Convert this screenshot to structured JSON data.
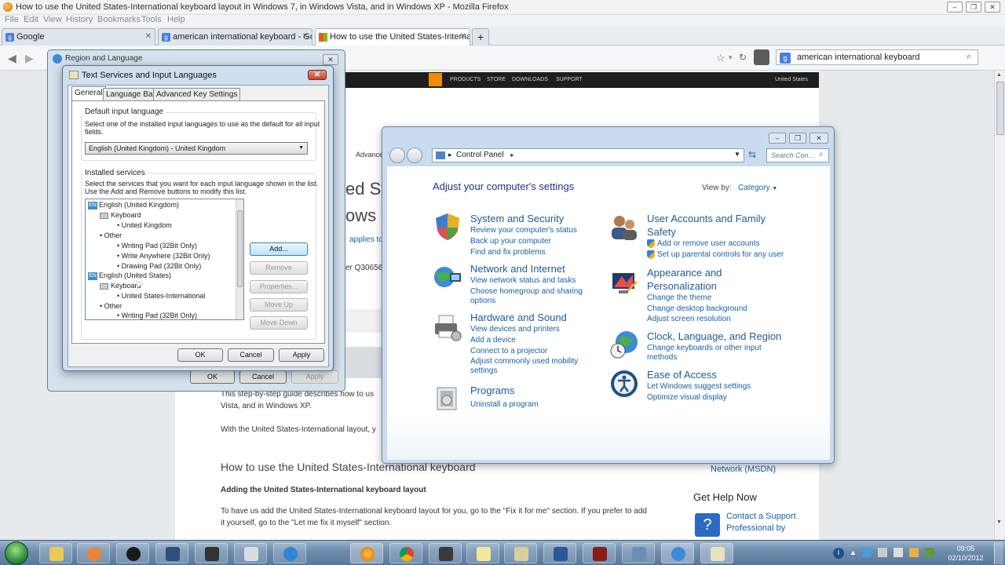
{
  "browser": {
    "title": "How to use the United States-International keyboard layout in Windows 7, in Windows Vista, and in Windows XP - Mozilla Firefox",
    "menu": [
      "File",
      "Edit",
      "View",
      "History",
      "Bookmarks",
      "Tools",
      "Help"
    ],
    "tabs": [
      {
        "label": "Google"
      },
      {
        "label": "american international keyboard - Go..."
      },
      {
        "label": "How to use the United States-Internat..."
      }
    ],
    "search_value": "american international keyboard"
  },
  "ms_header": {
    "links": [
      "PRODUCTS",
      "STORE",
      "DOWNLOADS",
      "SUPPORT"
    ],
    "region": "United States"
  },
  "article": {
    "frag_advanced": "Advance",
    "frag_title1": "ed St",
    "frag_title2": "ows",
    "frag_applies": "applies to",
    "frag_kb": "er Q30656",
    "para1_line1": "This step-by-step guide describes how to us",
    "para1_line2": "Vista, and in Windows XP.",
    "para2": "With the United States-International layout, y",
    "heading": "How to use the United States-International keyboard",
    "subheading": "Adding the United States-International keyboard layout",
    "body_line1": "To have us add the United States-International keyboard layout for you, go to the \"Fix it for me\" section. If you prefer to add",
    "body_line2": "it yourself, go to the \"Let me fix it myself\" section.",
    "side_msdn": "Network (MSDN)",
    "side_help": "Get Help Now",
    "side_contact": "Contact a Support",
    "side_prof": "Professional by"
  },
  "control_panel": {
    "address": "Control Panel",
    "search_placeholder": "Search Con...",
    "heading": "Adjust your computer's settings",
    "view_by_label": "View by:",
    "view_by_value": "Category",
    "categories": [
      {
        "title": "System and Security",
        "links": [
          "Review your computer's status",
          "Back up your computer",
          "Find and fix problems"
        ]
      },
      {
        "title": "Network and Internet",
        "links": [
          "View network status and tasks",
          "Choose homegroup and sharing",
          "options"
        ]
      },
      {
        "title": "Hardware and Sound",
        "links": [
          "View devices and printers",
          "Add a device",
          "Connect to a projector",
          "Adjust commonly used mobility",
          "settings"
        ]
      },
      {
        "title": "Programs",
        "links": [
          "Uninstall a program"
        ]
      },
      {
        "title": "User Accounts and Family",
        "title2": "Safety",
        "links": [
          "Add or remove user accounts",
          "Set up parental controls for any user"
        ]
      },
      {
        "title": "Appearance and",
        "title2": "Personalization",
        "links": [
          "Change the theme",
          "Change desktop background",
          "Adjust screen resolution"
        ]
      },
      {
        "title": "Clock, Language, and Region",
        "links": [
          "Change keyboards or other input",
          "methods"
        ]
      },
      {
        "title": "Ease of Access",
        "links": [
          "Let Windows suggest settings",
          "Optimize visual display"
        ]
      }
    ]
  },
  "region_dialog": {
    "title": "Region and Language",
    "ok": "OK",
    "cancel": "Cancel",
    "apply": "Apply"
  },
  "text_services": {
    "title": "Text Services and Input Languages",
    "tabs": [
      "General",
      "Language Bar",
      "Advanced Key Settings"
    ],
    "default_group": "Default input language",
    "default_desc1": "Select one of the installed input languages to use as the default for all input",
    "default_desc2": "fields.",
    "default_value": "English (United Kingdom) - United Kingdom",
    "installed_group": "Installed services",
    "installed_desc1": "Select the services that you want for each input language shown in the list.",
    "installed_desc2": "Use the Add and Remove buttons to modify this list.",
    "tree": {
      "lang1": "English (United Kingdom)",
      "keyboard": "Keyboard",
      "uk": "United Kingdom",
      "other": "Other",
      "writing_pad": "Writing Pad (32Bit Only)",
      "write_anywhere": "Write Anywhere (32Bit Only)",
      "drawing_pad": "Drawing Pad (32Bit Only)",
      "lang2": "English (United States)",
      "keyboard2": "Keyboard",
      "us_intl": "United States-International",
      "other2": "Other",
      "writing_pad2": "Writing Pad (32Bit Only)",
      "badge": "EN"
    },
    "buttons": {
      "add": "Add...",
      "remove": "Remove",
      "properties": "Properties...",
      "move_up": "Move Up",
      "move_down": "Move Down",
      "ok": "OK",
      "cancel": "Cancel",
      "apply": "Apply"
    }
  },
  "taskbar": {
    "time": "09:05",
    "date": "02/10/2012"
  }
}
